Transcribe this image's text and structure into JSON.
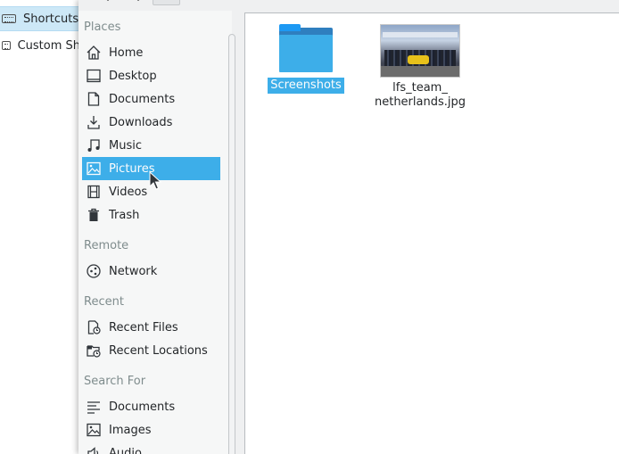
{
  "background_window": {
    "rows": [
      {
        "label": "Shortcuts",
        "selected": true
      },
      {
        "label": "Custom Sh",
        "selected": false
      }
    ]
  },
  "toolbar": {
    "chevron_1": "⌄",
    "chevron_2": "⌄"
  },
  "places_panel": {
    "sections": [
      {
        "title": "Places",
        "items": [
          {
            "label": "Home",
            "icon": "home-icon"
          },
          {
            "label": "Desktop",
            "icon": "desktop-icon"
          },
          {
            "label": "Documents",
            "icon": "document-icon"
          },
          {
            "label": "Downloads",
            "icon": "download-icon"
          },
          {
            "label": "Music",
            "icon": "music-icon"
          },
          {
            "label": "Pictures",
            "icon": "image-icon",
            "active": true
          },
          {
            "label": "Videos",
            "icon": "film-icon"
          },
          {
            "label": "Trash",
            "icon": "trash-icon"
          }
        ]
      },
      {
        "title": "Remote",
        "items": [
          {
            "label": "Network",
            "icon": "network-icon"
          }
        ]
      },
      {
        "title": "Recent",
        "items": [
          {
            "label": "Recent Files",
            "icon": "recent-files-icon"
          },
          {
            "label": "Recent Locations",
            "icon": "recent-locations-icon"
          }
        ]
      },
      {
        "title": "Search For",
        "items": [
          {
            "label": "Documents",
            "icon": "text-lines-icon"
          },
          {
            "label": "Images",
            "icon": "image-icon"
          },
          {
            "label": "Audio",
            "icon": "audio-icon"
          }
        ]
      }
    ]
  },
  "files": [
    {
      "name": "Screenshots",
      "type": "folder",
      "selected": true
    },
    {
      "name_line1": "lfs_team_",
      "name_line2": "netherlands.jpg",
      "type": "image",
      "selected": false
    }
  ],
  "colors": {
    "accent": "#3daee9",
    "panel_bg": "#eff0f1",
    "text": "#232629"
  }
}
